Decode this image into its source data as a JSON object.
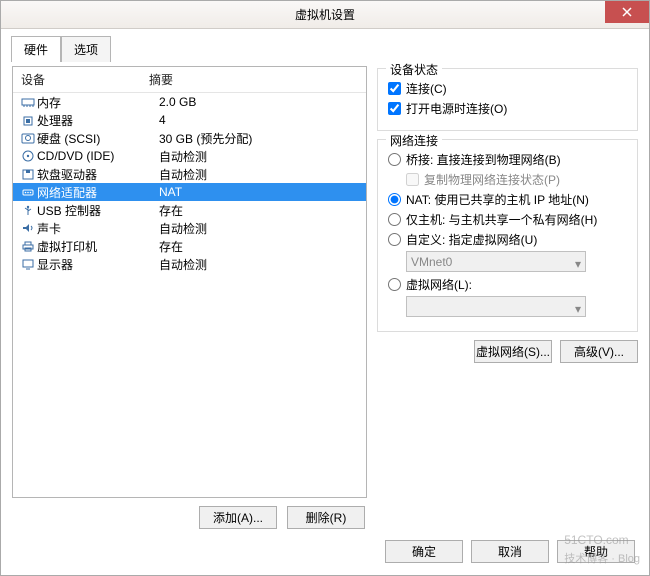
{
  "title": "虚拟机设置",
  "tabs": {
    "hardware": "硬件",
    "options": "选项"
  },
  "headers": {
    "device": "设备",
    "summary": "摘要"
  },
  "rows": [
    {
      "icon": "memory",
      "name": "内存",
      "summary": "2.0 GB"
    },
    {
      "icon": "cpu",
      "name": "处理器",
      "summary": "4"
    },
    {
      "icon": "hdd",
      "name": "硬盘 (SCSI)",
      "summary": "30 GB (预先分配)"
    },
    {
      "icon": "cd",
      "name": "CD/DVD (IDE)",
      "summary": "自动检测"
    },
    {
      "icon": "floppy",
      "name": "软盘驱动器",
      "summary": "自动检测"
    },
    {
      "icon": "net",
      "name": "网络适配器",
      "summary": "NAT"
    },
    {
      "icon": "usb",
      "name": "USB 控制器",
      "summary": "存在"
    },
    {
      "icon": "sound",
      "name": "声卡",
      "summary": "自动检测"
    },
    {
      "icon": "printer",
      "name": "虚拟打印机",
      "summary": "存在"
    },
    {
      "icon": "display",
      "name": "显示器",
      "summary": "自动检测"
    }
  ],
  "selected_index": 5,
  "buttons": {
    "add": "添加(A)...",
    "remove": "删除(R)",
    "lan": "虚拟网络(S)...",
    "adv": "高级(V)...",
    "ok": "确定",
    "cancel": "取消",
    "help": "帮助"
  },
  "group1": {
    "title": "设备状态",
    "connected": "连接(C)",
    "poweron": "打开电源时连接(O)"
  },
  "group2": {
    "title": "网络连接",
    "bridge": "桥接: 直接连接到物理网络(B)",
    "replicate": "复制物理网络连接状态(P)",
    "nat": "NAT: 使用已共享的主机 IP 地址(N)",
    "hostonly": "仅主机: 与主机共享一个私有网络(H)",
    "custom": "自定义: 指定虚拟网络(U)",
    "custom_value": "VMnet0",
    "lanseg": "虚拟网络(L):"
  },
  "watermark": {
    "big": "51CTO.com",
    "small": "技术博客 · Blog"
  }
}
